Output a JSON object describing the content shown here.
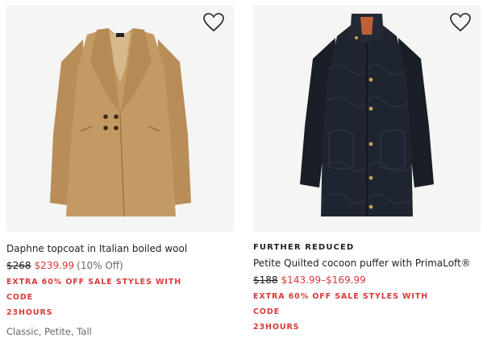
{
  "colors": {
    "sale": "#d93a3a",
    "camel": "#c39a63",
    "navy": "#1f2530",
    "image_bg": "#f5f5f3"
  },
  "products": [
    {
      "label": "",
      "title": "Daphne topcoat in Italian boiled wool",
      "original_price": "$268",
      "sale_price": "$239.99",
      "discount": "(10% Off)",
      "promo_line1": "EXTRA 60% OFF SALE STYLES WITH CODE",
      "promo_line2": "23HOURS",
      "sizes": "Classic, Petite, Tall",
      "image": "camel-wool-topcoat",
      "wishlist_icon": "heart-outline-icon"
    },
    {
      "label": "FURTHER REDUCED",
      "title": "Petite Quilted cocoon puffer with PrimaLoft®",
      "original_price": "$188",
      "sale_price": "$143.99–$169.99",
      "discount": "",
      "promo_line1": "EXTRA 60% OFF SALE STYLES WITH CODE",
      "promo_line2": "23HOURS",
      "sizes": "",
      "image": "navy-quilted-puffer-coat",
      "wishlist_icon": "heart-outline-icon"
    }
  ]
}
